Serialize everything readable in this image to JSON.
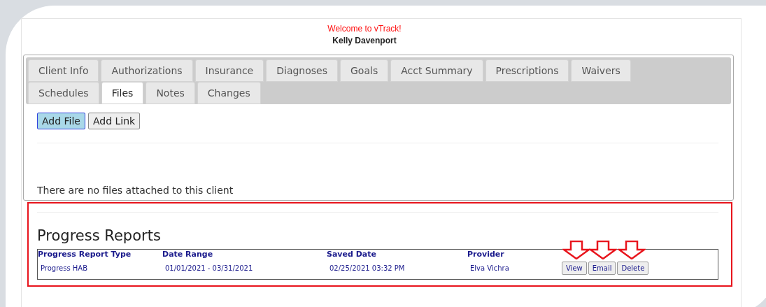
{
  "header": {
    "welcome": "Welcome to vTrack!",
    "user": "Kelly Davenport"
  },
  "tabs": [
    {
      "label": "Client Info",
      "selected": false
    },
    {
      "label": "Authorizations",
      "selected": false
    },
    {
      "label": "Insurance",
      "selected": false
    },
    {
      "label": "Diagnoses",
      "selected": false
    },
    {
      "label": "Goals",
      "selected": false
    },
    {
      "label": "Acct Summary",
      "selected": false
    },
    {
      "label": "Prescriptions",
      "selected": false
    },
    {
      "label": "Waivers",
      "selected": false
    },
    {
      "label": "Schedules",
      "selected": false
    },
    {
      "label": "Files",
      "selected": true
    },
    {
      "label": "Notes",
      "selected": false
    },
    {
      "label": "Changes",
      "selected": false
    }
  ],
  "file_buttons": [
    {
      "label": "Add File",
      "selected": true
    },
    {
      "label": "Add Link",
      "selected": false
    }
  ],
  "empty_message": "There are no files attached to this client",
  "progress_reports": {
    "title": "Progress Reports",
    "columns": [
      "Progress Report Type",
      "Date Range",
      "Saved Date",
      "Provider"
    ],
    "rows": [
      {
        "cells": [
          "Progress HAB",
          "01/01/2021 - 03/31/2021",
          "02/25/2021 03:32 PM",
          "Elva Vichra"
        ],
        "actions": [
          "View",
          "Email",
          "Delete"
        ]
      }
    ]
  }
}
